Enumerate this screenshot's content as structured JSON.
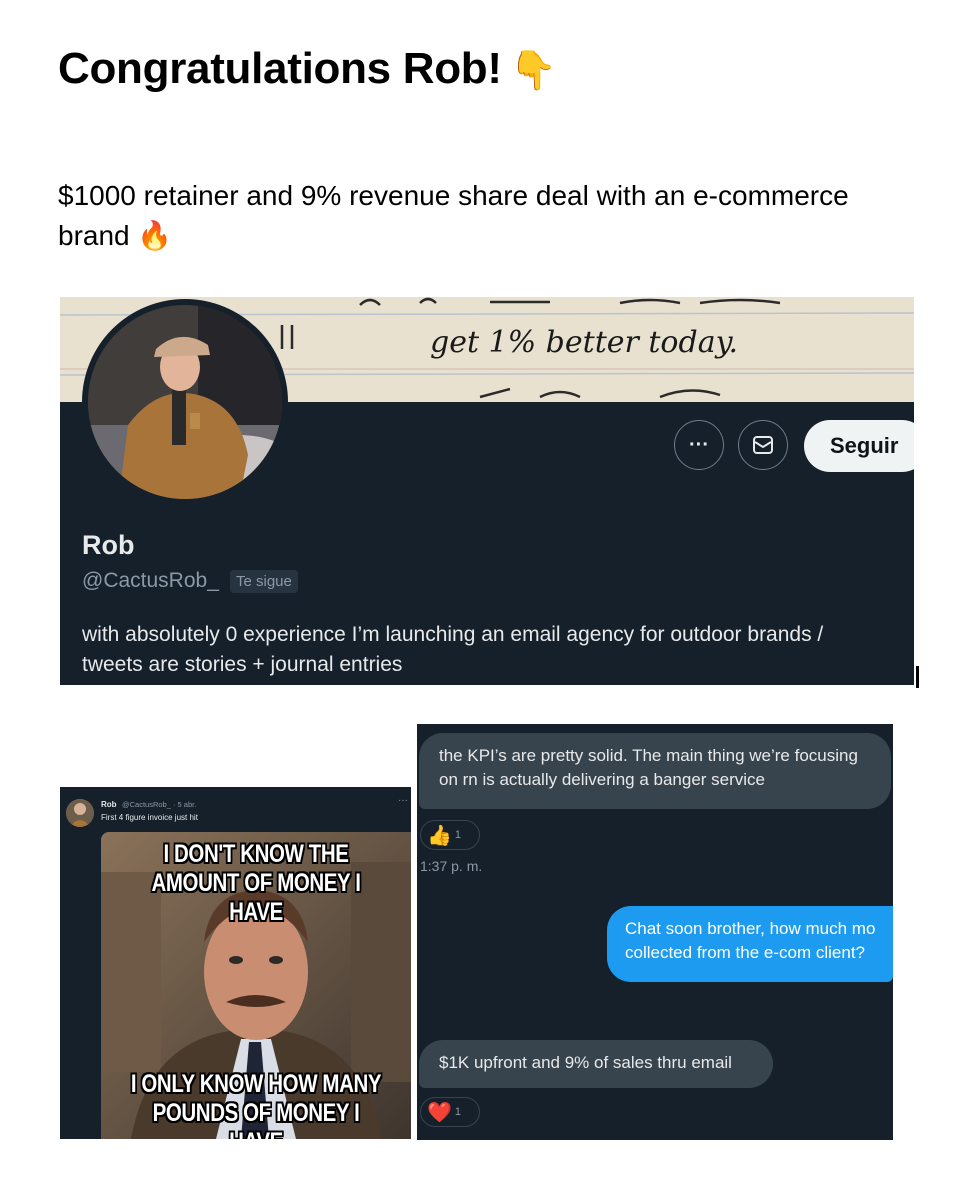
{
  "post": {
    "title": "Congratulations Rob!",
    "title_emoji": "👇",
    "subtitle": "$1000 retainer and 9% revenue share deal with an e-commerce brand",
    "subtitle_emoji": "🔥"
  },
  "profile": {
    "banner_text": "get 1% better today.",
    "name": "Rob",
    "handle": "@CactusRob_",
    "follows_you": "Te sigue",
    "bio_line1": "with absolutely 0 experience I’m launching an email agency for outdoor brands /",
    "bio_line2": "tweets are stories + journal entries",
    "more_glyph": "···",
    "follow_label": "Seguir",
    "icons": {
      "more": "more-icon",
      "message": "envelope-icon"
    }
  },
  "tweet": {
    "name": "Rob",
    "meta": "@CactusRob_ · 5 abr.",
    "more_glyph": "···",
    "text": "First 4 figure invoice just hit",
    "meme_top": "I DON'T KNOW THE AMOUNT OF MONEY I HAVE",
    "meme_bottom": "I ONLY KNOW HOW MANY POUNDS OF MONEY I HAVE"
  },
  "dm": {
    "msg1": "the KPI’s are pretty solid. The main thing we’re focusing on rn is actually delivering a banger service",
    "reaction1_emoji": "👍",
    "reaction1_count": "1",
    "time1": "1:37 p. m.",
    "msg2": "Chat soon brother, how much mo collected from the e-com client?",
    "msg2_line1": "Chat soon brother, how much mo",
    "msg2_line2": "collected from the e-com client?",
    "msg3": "$1K upfront and 9% of sales thru email",
    "reaction2_emoji": "❤️",
    "reaction2_count": "1"
  },
  "colors": {
    "dark_bg": "#15202b",
    "incoming_bubble": "#38444d",
    "outgoing_bubble": "#1d9bf0",
    "follow_button": "#eff3f4"
  }
}
